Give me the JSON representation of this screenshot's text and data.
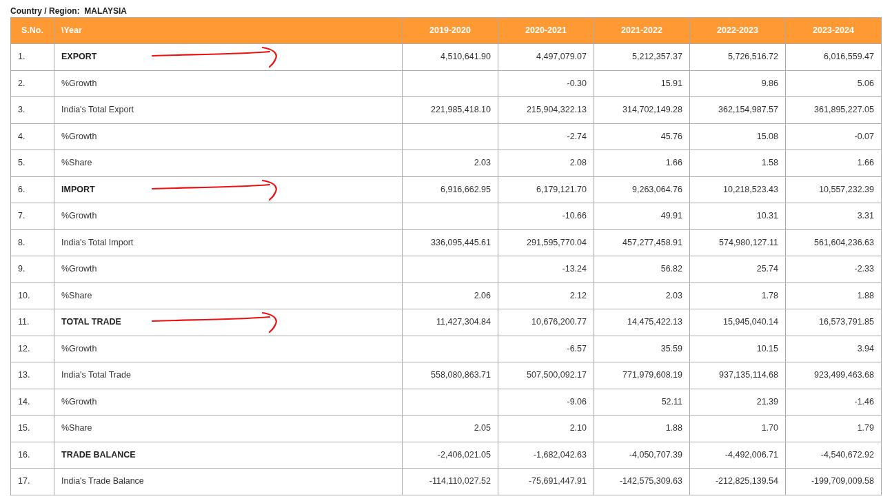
{
  "region": {
    "label": "Country / Region:",
    "value": "MALAYSIA"
  },
  "table": {
    "columns": [
      "S.No.",
      "\\Year",
      "2019-2020",
      "2020-2021",
      "2021-2022",
      "2022-2023",
      "2023-2024"
    ],
    "rows": [
      {
        "no": "1.",
        "label": "EXPORT",
        "kind": "heading",
        "arrow": true,
        "values": {
          "fy1": "4,510,641.90",
          "fy2": "4,497,079.07",
          "fy3": "5,212,357.37",
          "fy4": "5,726,516.72",
          "fy5": "6,016,559.47"
        }
      },
      {
        "no": "2.",
        "label": "%Growth",
        "kind": "plain",
        "arrow": false,
        "values": {
          "fy2": "-0.30",
          "fy3": "15.91",
          "fy4": "9.86",
          "fy5": "5.06"
        }
      },
      {
        "no": "3.",
        "label": "India's Total Export",
        "kind": "plain",
        "arrow": false,
        "values": {
          "fy1": "221,985,418.10",
          "fy2": "215,904,322.13",
          "fy3": "314,702,149.28",
          "fy4": "362,154,987.57",
          "fy5": "361,895,227.05"
        }
      },
      {
        "no": "4.",
        "label": "%Growth",
        "kind": "plain",
        "arrow": false,
        "values": {
          "fy2": "-2.74",
          "fy3": "45.76",
          "fy4": "15.08",
          "fy5": "-0.07"
        }
      },
      {
        "no": "5.",
        "label": "%Share",
        "kind": "plain",
        "arrow": false,
        "values": {
          "fy1": "2.03",
          "fy2": "2.08",
          "fy3": "1.66",
          "fy4": "1.58",
          "fy5": "1.66"
        }
      },
      {
        "no": "6.",
        "label": "IMPORT",
        "kind": "heading",
        "arrow": true,
        "values": {
          "fy1": "6,916,662.95",
          "fy2": "6,179,121.70",
          "fy3": "9,263,064.76",
          "fy4": "10,218,523.43",
          "fy5": "10,557,232.39"
        }
      },
      {
        "no": "7.",
        "label": "%Growth",
        "kind": "plain",
        "arrow": false,
        "values": {
          "fy2": "-10.66",
          "fy3": "49.91",
          "fy4": "10.31",
          "fy5": "3.31"
        }
      },
      {
        "no": "8.",
        "label": "India's Total Import",
        "kind": "plain",
        "arrow": false,
        "values": {
          "fy1": "336,095,445.61",
          "fy2": "291,595,770.04",
          "fy3": "457,277,458.91",
          "fy4": "574,980,127.11",
          "fy5": "561,604,236.63"
        }
      },
      {
        "no": "9.",
        "label": "%Growth",
        "kind": "plain",
        "arrow": false,
        "values": {
          "fy2": "-13.24",
          "fy3": "56.82",
          "fy4": "25.74",
          "fy5": "-2.33"
        }
      },
      {
        "no": "10.",
        "label": "%Share",
        "kind": "plain",
        "arrow": false,
        "values": {
          "fy1": "2.06",
          "fy2": "2.12",
          "fy3": "2.03",
          "fy4": "1.78",
          "fy5": "1.88"
        }
      },
      {
        "no": "11.",
        "label": "TOTAL TRADE",
        "kind": "heading",
        "arrow": true,
        "values": {
          "fy1": "11,427,304.84",
          "fy2": "10,676,200.77",
          "fy3": "14,475,422.13",
          "fy4": "15,945,040.14",
          "fy5": "16,573,791.85"
        }
      },
      {
        "no": "12.",
        "label": "%Growth",
        "kind": "plain",
        "arrow": false,
        "values": {
          "fy2": "-6.57",
          "fy3": "35.59",
          "fy4": "10.15",
          "fy5": "3.94"
        }
      },
      {
        "no": "13.",
        "label": "India's Total Trade",
        "kind": "plain",
        "arrow": false,
        "values": {
          "fy1": "558,080,863.71",
          "fy2": "507,500,092.17",
          "fy3": "771,979,608.19",
          "fy4": "937,135,114.68",
          "fy5": "923,499,463.68"
        }
      },
      {
        "no": "14.",
        "label": "%Growth",
        "kind": "plain",
        "arrow": false,
        "values": {
          "fy2": "-9.06",
          "fy3": "52.11",
          "fy4": "21.39",
          "fy5": "-1.46"
        }
      },
      {
        "no": "15.",
        "label": "%Share",
        "kind": "plain",
        "arrow": false,
        "values": {
          "fy1": "2.05",
          "fy2": "2.10",
          "fy3": "1.88",
          "fy4": "1.70",
          "fy5": "1.79"
        }
      },
      {
        "no": "16.",
        "label": "TRADE BALANCE",
        "kind": "heading",
        "arrow": false,
        "values": {
          "fy1": "-2,406,021.05",
          "fy2": "-1,682,042.63",
          "fy3": "-4,050,707.39",
          "fy4": "-4,492,006.71",
          "fy5": "-4,540,672.92"
        }
      },
      {
        "no": "17.",
        "label": "India's Trade Balance",
        "kind": "plain",
        "arrow": false,
        "values": {
          "fy1": "-114,110,027.52",
          "fy2": "-75,691,447.91",
          "fy3": "-142,575,309.63",
          "fy4": "-212,825,139.54",
          "fy5": "-199,709,009.58"
        }
      }
    ]
  }
}
